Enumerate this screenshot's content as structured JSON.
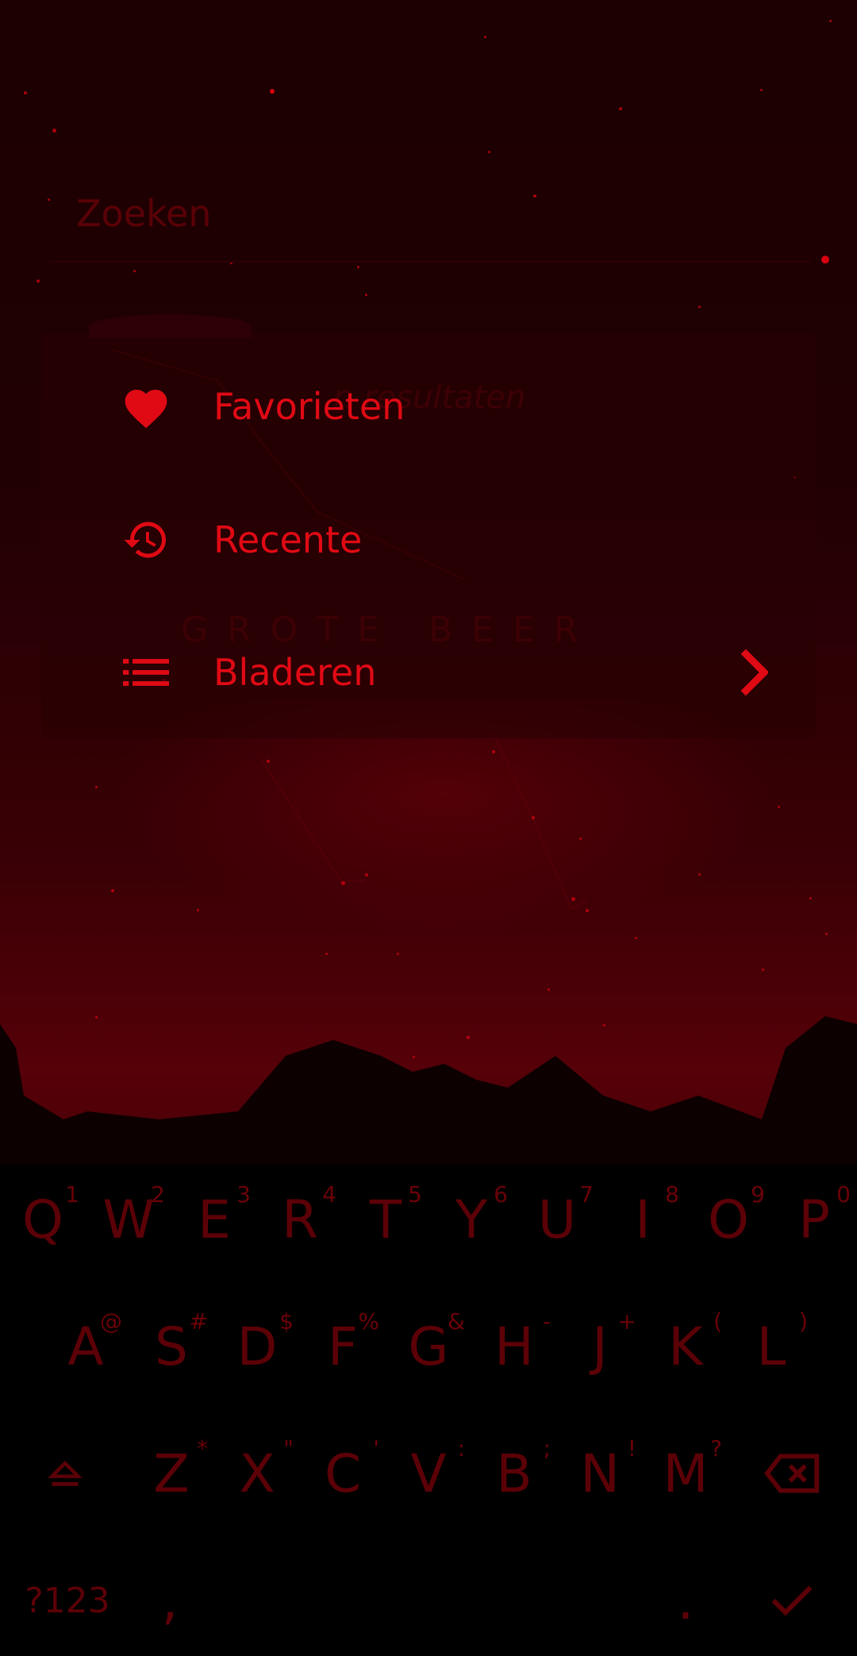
{
  "search": {
    "placeholder": "Zoeken",
    "value": ""
  },
  "ghost": {
    "no_results": "n resultaten",
    "constellation": "GROTE BEER"
  },
  "menu": {
    "items": [
      {
        "label": "Favorieten",
        "icon": "heart-icon"
      },
      {
        "label": "Recente",
        "icon": "history-icon"
      },
      {
        "label": "Bladeren",
        "icon": "list-icon"
      }
    ]
  },
  "keyboard": {
    "row1": [
      {
        "key": "Q",
        "hint": "1"
      },
      {
        "key": "W",
        "hint": "2"
      },
      {
        "key": "E",
        "hint": "3"
      },
      {
        "key": "R",
        "hint": "4"
      },
      {
        "key": "T",
        "hint": "5"
      },
      {
        "key": "Y",
        "hint": "6"
      },
      {
        "key": "U",
        "hint": "7"
      },
      {
        "key": "I",
        "hint": "8"
      },
      {
        "key": "O",
        "hint": "9"
      },
      {
        "key": "P",
        "hint": "0"
      }
    ],
    "row2": [
      {
        "key": "A",
        "hint": "@"
      },
      {
        "key": "S",
        "hint": "#"
      },
      {
        "key": "D",
        "hint": "$"
      },
      {
        "key": "F",
        "hint": "%"
      },
      {
        "key": "G",
        "hint": "&"
      },
      {
        "key": "H",
        "hint": "-"
      },
      {
        "key": "J",
        "hint": "+"
      },
      {
        "key": "K",
        "hint": "("
      },
      {
        "key": "L",
        "hint": ")"
      }
    ],
    "row3": [
      {
        "key": "Z",
        "hint": "*"
      },
      {
        "key": "X",
        "hint": "\""
      },
      {
        "key": "C",
        "hint": "'"
      },
      {
        "key": "V",
        "hint": ":"
      },
      {
        "key": "B",
        "hint": ";"
      },
      {
        "key": "N",
        "hint": "!"
      },
      {
        "key": "M",
        "hint": "?"
      }
    ],
    "symbols_label": "?123",
    "comma_label": ",",
    "period_label": ".",
    "shift_icon": "shift-icon",
    "backspace_icon": "backspace-icon",
    "done_icon": "check-icon"
  },
  "colors": {
    "accent": "#e00a14",
    "dim": "#5c0007",
    "background": "#1c0002"
  }
}
